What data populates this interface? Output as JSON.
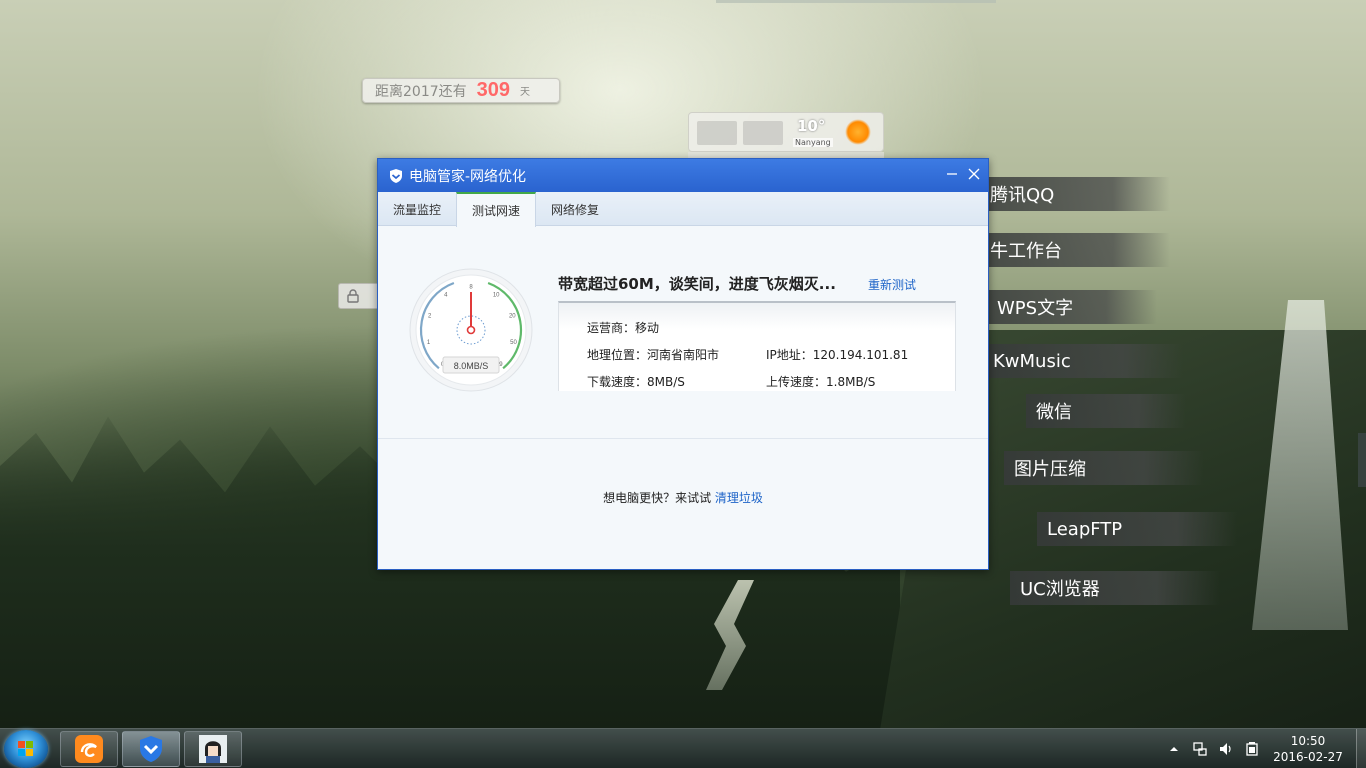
{
  "countdown": {
    "prefix": "距离2017还有",
    "value": "309",
    "unit": "天"
  },
  "weather": {
    "temperature": "10°",
    "city": "Nanyang"
  },
  "launcher": [
    {
      "label": "腾讯QQ",
      "icon": "qq-icon"
    },
    {
      "label": "牛工作台",
      "icon": "workbench-icon"
    },
    {
      "label": "WPS文字",
      "icon": "wps-icon"
    },
    {
      "label": "KwMusic",
      "icon": "music-icon"
    },
    {
      "label": "微信",
      "icon": "wechat-icon"
    },
    {
      "label": "图片压缩",
      "icon": "image-compress-icon"
    },
    {
      "label": "LeapFTP",
      "icon": "ftp-icon"
    },
    {
      "label": "UC浏览器",
      "icon": "uc-browser-icon"
    }
  ],
  "window": {
    "title": "电脑管家-网络优化",
    "tabs": [
      {
        "label": "流量监控",
        "active": false
      },
      {
        "label": "测试网速",
        "active": true
      },
      {
        "label": "网络修复",
        "active": false
      }
    ],
    "gauge": {
      "ticks": [
        "0",
        "1",
        "2",
        "4",
        "8",
        "10",
        "20",
        "50",
        "99"
      ],
      "readout": "8.0MB/S",
      "level_mb": 8
    },
    "headline": "带宽超过60M，谈笑间，进度飞灰烟灭...",
    "retest_label": "重新测试",
    "info": {
      "isp": "运营商：移动",
      "location": "地理位置：河南省南阳市",
      "ip": "IP地址：120.194.101.81",
      "download": "下载速度：8MB/S",
      "upload": "上传速度：1.8MB/S"
    },
    "promo_text": "想电脑更快？来试试",
    "promo_link": "清理垃圾"
  },
  "taskbar": {
    "apps": [
      {
        "name": "uc-browser-task",
        "icon": "uc-icon"
      },
      {
        "name": "pc-manager-task",
        "icon": "shield-icon",
        "active": true
      },
      {
        "name": "image-viewer-task",
        "icon": "anime-avatar-icon"
      }
    ],
    "time": "10:50",
    "date": "2016-02-27"
  },
  "colors": {
    "title_blue": "#2a63cf",
    "link_blue": "#1e64c8",
    "tab_green": "#42a849",
    "gauge_red": "#e03a3a",
    "countdown_red": "#ff6868"
  }
}
